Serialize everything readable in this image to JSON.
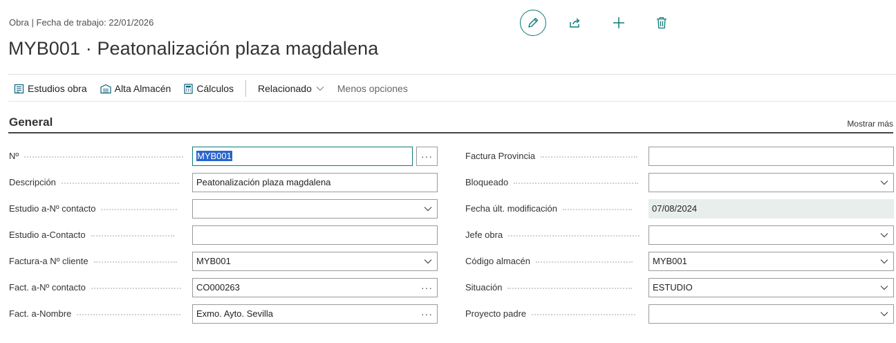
{
  "header": {
    "breadcrumb": "Obra | Fecha de trabajo: 22/01/2026",
    "title": "MYB001 · Peatonalización plaza magdalena"
  },
  "toolbar": {
    "estudios": "Estudios obra",
    "alta_almacen": "Alta Almacén",
    "calculos": "Cálculos",
    "relacionado": "Relacionado",
    "menos_opciones": "Menos opciones"
  },
  "section": {
    "title": "General",
    "show_more": "Mostrar más"
  },
  "colors": {
    "accent": "#0b7a75",
    "selection": "#2965cc",
    "readonly_bg": "#e8eeec"
  },
  "left_fields": [
    {
      "label": "Nº",
      "value": "MYB001"
    },
    {
      "label": "Descripción",
      "value": "Peatonalización plaza magdalena"
    },
    {
      "label": "Estudio a-Nº contacto",
      "value": ""
    },
    {
      "label": "Estudio a-Contacto",
      "value": ""
    },
    {
      "label": "Factura-a Nº cliente",
      "value": "MYB001"
    },
    {
      "label": "Fact. a-Nº contacto",
      "value": "CO000263"
    },
    {
      "label": "Fact. a-Nombre",
      "value": "Exmo. Ayto. Sevilla"
    }
  ],
  "right_fields": [
    {
      "label": "Factura Provincia",
      "value": ""
    },
    {
      "label": "Bloqueado",
      "value": ""
    },
    {
      "label": "Fecha últ. modificación",
      "value": "07/08/2024"
    },
    {
      "label": "Jefe obra",
      "value": ""
    },
    {
      "label": "Código almacén",
      "value": "MYB001"
    },
    {
      "label": "Situación",
      "value": "ESTUDIO"
    },
    {
      "label": "Proyecto padre",
      "value": ""
    }
  ],
  "ellipsis": "···"
}
